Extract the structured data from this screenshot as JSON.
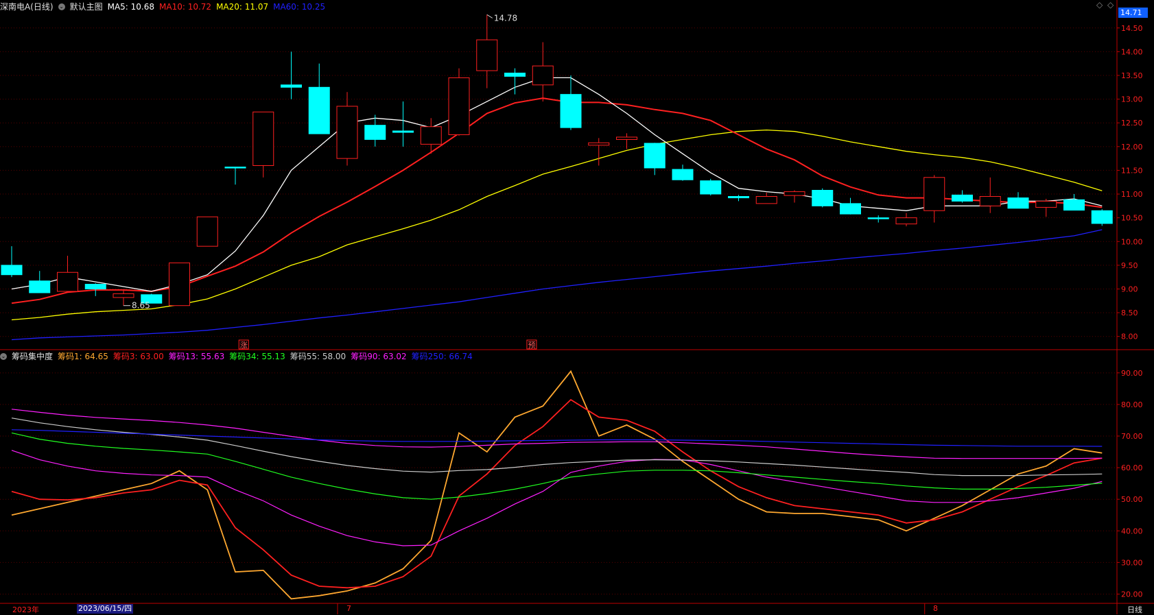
{
  "header_top": {
    "stock_name": "深南电A(日线)",
    "chart_title": "默认主图",
    "ma": [
      {
        "label": "MA5: 10.68",
        "color": "#ffffff"
      },
      {
        "label": "MA10: 10.72",
        "color": "#ff2020"
      },
      {
        "label": "MA20: 11.07",
        "color": "#ffff00"
      },
      {
        "label": "MA60: 10.25",
        "color": "#2020ff"
      }
    ]
  },
  "header_bottom": {
    "indicator_title": "筹码集中度",
    "lines": [
      {
        "label": "筹码1: 64.65",
        "color": "#ffa830"
      },
      {
        "label": "筹码3: 63.00",
        "color": "#ff2020"
      },
      {
        "label": "筹码13: 55.63",
        "color": "#ff20ff"
      },
      {
        "label": "筹码34: 55.13",
        "color": "#20ff20"
      },
      {
        "label": "筹码55: 58.00",
        "color": "#cccccc"
      },
      {
        "label": "筹码90: 63.02",
        "color": "#ff20ff"
      },
      {
        "label": "筹码250: 66.74",
        "color": "#2020ff"
      }
    ]
  },
  "current_price": "14.71",
  "period_label": "日线",
  "dates": {
    "year_label": "2023年",
    "cursor_date": "2023/06/15/四",
    "month_labels": [
      "7",
      "8"
    ]
  },
  "annotations": {
    "high_label": "14.78",
    "low_label": "8.65",
    "event_1": "涨",
    "event_2": "预"
  },
  "colors": {
    "up": "#ff2020",
    "down": "#00ffff",
    "ma5": "#ffffff",
    "ma10": "#ff2020",
    "ma20": "#ffff00",
    "ma60": "#2020ff",
    "axis": "#c00000"
  },
  "chart_data": [
    {
      "type": "candlestick",
      "title": "深南电A(日线)",
      "y_ticks": [
        8.0,
        8.5,
        9.0,
        9.5,
        10.0,
        10.5,
        11.0,
        11.5,
        12.0,
        12.5,
        13.0,
        13.5,
        14.0,
        14.5
      ],
      "y_tick_labels": [
        "8.00",
        "8.50",
        "9.00",
        "9.50",
        "10.00",
        "10.50",
        "11.00",
        "11.50",
        "12.00",
        "12.50",
        "13.00",
        "13.50",
        "14.00",
        "14.50"
      ],
      "ylim": [
        7.75,
        14.8
      ],
      "candles": [
        {
          "o": 9.5,
          "h": 9.9,
          "l": 9.25,
          "c": 9.3
        },
        {
          "o": 9.17,
          "h": 9.38,
          "l": 8.92,
          "c": 8.92
        },
        {
          "o": 8.95,
          "h": 9.7,
          "l": 8.95,
          "c": 9.35
        },
        {
          "o": 9.1,
          "h": 9.12,
          "l": 8.85,
          "c": 9.0
        },
        {
          "o": 8.82,
          "h": 8.97,
          "l": 8.65,
          "c": 8.9
        },
        {
          "o": 8.88,
          "h": 8.9,
          "l": 8.7,
          "c": 8.7
        },
        {
          "o": 8.65,
          "h": 9.55,
          "l": 8.65,
          "c": 9.55
        },
        {
          "o": 9.9,
          "h": 10.52,
          "l": 9.9,
          "c": 10.52
        },
        {
          "o": 11.57,
          "h": 11.57,
          "l": 11.2,
          "c": 11.57
        },
        {
          "o": 11.6,
          "h": 12.73,
          "l": 11.35,
          "c": 12.73
        },
        {
          "o": 13.3,
          "h": 14.0,
          "l": 13.0,
          "c": 13.25
        },
        {
          "o": 13.25,
          "h": 13.75,
          "l": 12.27,
          "c": 12.27
        },
        {
          "o": 11.75,
          "h": 13.15,
          "l": 11.6,
          "c": 12.85
        },
        {
          "o": 12.45,
          "h": 12.67,
          "l": 12.0,
          "c": 12.15
        },
        {
          "o": 12.33,
          "h": 12.95,
          "l": 12.0,
          "c": 12.3
        },
        {
          "o": 12.05,
          "h": 12.6,
          "l": 11.85,
          "c": 12.42
        },
        {
          "o": 12.25,
          "h": 13.65,
          "l": 12.23,
          "c": 13.45
        },
        {
          "o": 13.6,
          "h": 14.78,
          "l": 13.23,
          "c": 14.25
        },
        {
          "o": 13.55,
          "h": 13.65,
          "l": 13.1,
          "c": 13.48
        },
        {
          "o": 13.3,
          "h": 14.2,
          "l": 12.95,
          "c": 13.7
        },
        {
          "o": 13.1,
          "h": 13.5,
          "l": 12.35,
          "c": 12.4
        },
        {
          "o": 12.03,
          "h": 12.18,
          "l": 11.6,
          "c": 12.08
        },
        {
          "o": 12.15,
          "h": 12.28,
          "l": 11.95,
          "c": 12.2
        },
        {
          "o": 12.07,
          "h": 12.08,
          "l": 11.4,
          "c": 11.55
        },
        {
          "o": 11.52,
          "h": 11.62,
          "l": 11.28,
          "c": 11.3
        },
        {
          "o": 11.28,
          "h": 11.32,
          "l": 10.97,
          "c": 11.0
        },
        {
          "o": 10.95,
          "h": 10.98,
          "l": 10.85,
          "c": 10.92
        },
        {
          "o": 10.8,
          "h": 11.03,
          "l": 10.8,
          "c": 10.95
        },
        {
          "o": 10.97,
          "h": 11.08,
          "l": 10.82,
          "c": 11.05
        },
        {
          "o": 11.08,
          "h": 11.12,
          "l": 10.72,
          "c": 10.75
        },
        {
          "o": 10.8,
          "h": 10.92,
          "l": 10.57,
          "c": 10.58
        },
        {
          "o": 10.5,
          "h": 10.55,
          "l": 10.4,
          "c": 10.5
        },
        {
          "o": 10.37,
          "h": 10.6,
          "l": 10.32,
          "c": 10.5
        },
        {
          "o": 10.65,
          "h": 11.4,
          "l": 10.4,
          "c": 11.35
        },
        {
          "o": 10.98,
          "h": 11.08,
          "l": 10.82,
          "c": 10.85
        },
        {
          "o": 10.75,
          "h": 11.35,
          "l": 10.6,
          "c": 10.95
        },
        {
          "o": 10.92,
          "h": 11.04,
          "l": 10.7,
          "c": 10.7
        },
        {
          "o": 10.72,
          "h": 10.9,
          "l": 10.52,
          "c": 10.85
        },
        {
          "o": 10.88,
          "h": 11.0,
          "l": 10.68,
          "c": 10.66
        },
        {
          "o": 10.65,
          "h": 10.68,
          "l": 10.33,
          "c": 10.38
        }
      ],
      "ma5": [
        9.0,
        9.1,
        9.25,
        9.15,
        9.05,
        8.95,
        9.1,
        9.3,
        9.8,
        10.55,
        11.5,
        12.0,
        12.5,
        12.6,
        12.55,
        12.4,
        12.65,
        12.95,
        13.25,
        13.45,
        13.45,
        13.1,
        12.7,
        12.25,
        11.85,
        11.45,
        11.12,
        11.05,
        11.0,
        10.9,
        10.75,
        10.7,
        10.65,
        10.75,
        10.75,
        10.75,
        10.85,
        10.85,
        10.9,
        10.75
      ],
      "ma10": [
        8.7,
        8.78,
        8.93,
        8.98,
        8.98,
        8.95,
        9.05,
        9.27,
        9.48,
        9.78,
        10.18,
        10.53,
        10.83,
        11.16,
        11.5,
        11.88,
        12.28,
        12.7,
        12.92,
        13.02,
        12.93,
        12.93,
        12.88,
        12.78,
        12.7,
        12.55,
        12.25,
        11.95,
        11.72,
        11.38,
        11.15,
        10.98,
        10.92,
        10.92,
        10.88,
        10.85,
        10.82,
        10.83,
        10.8,
        10.72
      ],
      "ma20": [
        8.35,
        8.4,
        8.47,
        8.52,
        8.55,
        8.58,
        8.67,
        8.79,
        9.0,
        9.25,
        9.5,
        9.68,
        9.93,
        10.1,
        10.27,
        10.45,
        10.67,
        10.95,
        11.18,
        11.42,
        11.58,
        11.75,
        11.92,
        12.05,
        12.15,
        12.25,
        12.32,
        12.35,
        12.32,
        12.22,
        12.1,
        12.0,
        11.9,
        11.83,
        11.77,
        11.68,
        11.55,
        11.4,
        11.25,
        11.07
      ],
      "ma60": [
        7.93,
        7.97,
        7.99,
        8.01,
        8.03,
        8.06,
        8.09,
        8.13,
        8.19,
        8.25,
        8.32,
        8.39,
        8.45,
        8.52,
        8.59,
        8.66,
        8.73,
        8.82,
        8.91,
        9.0,
        9.07,
        9.14,
        9.2,
        9.26,
        9.32,
        9.38,
        9.43,
        9.48,
        9.54,
        9.59,
        9.65,
        9.7,
        9.75,
        9.81,
        9.86,
        9.92,
        9.98,
        10.05,
        10.12,
        10.25
      ]
    },
    {
      "type": "line",
      "title": "筹码集中度",
      "y_ticks": [
        20,
        30,
        40,
        50,
        60,
        70,
        80,
        90
      ],
      "y_tick_labels": [
        "20.00",
        "30.00",
        "40.00",
        "50.00",
        "60.00",
        "70.00",
        "80.00",
        "90.00"
      ],
      "ylim": [
        17.5,
        93
      ],
      "series": [
        {
          "name": "筹码1",
          "color": "#ffa830",
          "values": [
            45,
            47,
            49,
            51,
            53,
            55,
            59,
            53,
            27,
            27.5,
            18.5,
            19.5,
            21,
            23.5,
            28,
            37,
            71,
            65,
            76,
            79.5,
            90.5,
            70,
            73.5,
            69,
            62,
            56,
            50,
            46,
            45.5,
            45.5,
            44.5,
            43.5,
            40,
            44,
            48,
            53,
            58,
            60.5,
            66,
            64.65
          ]
        },
        {
          "name": "筹码3",
          "color": "#ff2020",
          "values": [
            52.5,
            50,
            49.8,
            50.5,
            52,
            53,
            56,
            54.5,
            41,
            34,
            26,
            22.5,
            22,
            22.5,
            25.5,
            32,
            51,
            58,
            67,
            73,
            81.5,
            76,
            75,
            71.5,
            65,
            59,
            54,
            50.5,
            48,
            47,
            46,
            45,
            42.5,
            43.5,
            46,
            50,
            54,
            57.5,
            61.5,
            63
          ]
        },
        {
          "name": "筹码13",
          "color": "#ff20ff",
          "values": [
            65.5,
            62.5,
            60.5,
            59,
            58.2,
            57.7,
            57.5,
            57,
            53,
            49.5,
            45,
            41.5,
            38.5,
            36.5,
            35.3,
            35.5,
            40,
            44,
            48.5,
            52.5,
            58.5,
            60.5,
            62,
            62.6,
            62.5,
            61,
            59,
            57,
            55.5,
            54,
            52.5,
            51,
            49.5,
            49,
            49,
            49.5,
            50.5,
            52,
            53.5,
            55.63
          ]
        },
        {
          "name": "筹码34",
          "color": "#20ff20",
          "values": [
            71,
            69,
            67.7,
            66.8,
            66.1,
            65.6,
            65,
            64.3,
            62,
            59.5,
            57,
            55,
            53.2,
            51.7,
            50.5,
            50,
            50.7,
            51.8,
            53.2,
            55,
            57,
            58,
            58.9,
            59.2,
            59.2,
            59,
            58.4,
            57.7,
            57,
            56.3,
            55.6,
            55,
            54.2,
            53.6,
            53.2,
            53.2,
            53.4,
            53.8,
            54.4,
            55.13
          ]
        },
        {
          "name": "筹码55",
          "color": "#cccccc",
          "values": [
            75.7,
            74.2,
            73,
            72,
            71.2,
            70.5,
            69.7,
            68.7,
            67,
            65.2,
            63.5,
            62,
            60.7,
            59.7,
            58.9,
            58.6,
            59.1,
            59.4,
            60.1,
            61,
            61.6,
            62,
            62.4,
            62.5,
            62.4,
            62.2,
            61.8,
            61.3,
            60.8,
            60.2,
            59.6,
            59,
            58.5,
            57.8,
            57.5,
            57.5,
            57.5,
            57.7,
            57.8,
            58
          ]
        },
        {
          "name": "筹码90",
          "color": "#ff20ff",
          "values": [
            78.5,
            77.5,
            76.6,
            75.9,
            75.4,
            74.9,
            74.3,
            73.5,
            72.5,
            71.2,
            69.9,
            68.7,
            67.7,
            67,
            66.6,
            66.5,
            66.7,
            67.1,
            67.5,
            67.7,
            68,
            68.1,
            68.2,
            68.2,
            67.9,
            67.5,
            67.1,
            66.6,
            65.9,
            65.2,
            64.5,
            63.9,
            63.4,
            63,
            62.9,
            62.9,
            62.9,
            62.9,
            62.9,
            63.02
          ]
        },
        {
          "name": "筹码250",
          "color": "#2020ff",
          "values": [
            72,
            71.8,
            71.5,
            71.2,
            70.9,
            70.6,
            70.3,
            70,
            69.7,
            69.4,
            69.1,
            68.8,
            68.6,
            68.4,
            68.3,
            68.3,
            68.3,
            68.4,
            68.5,
            68.6,
            68.7,
            68.8,
            68.8,
            68.8,
            68.7,
            68.6,
            68.5,
            68.3,
            68.1,
            67.9,
            67.7,
            67.5,
            67.3,
            67.1,
            67,
            66.9,
            66.8,
            66.8,
            66.8,
            66.74
          ]
        }
      ]
    }
  ]
}
